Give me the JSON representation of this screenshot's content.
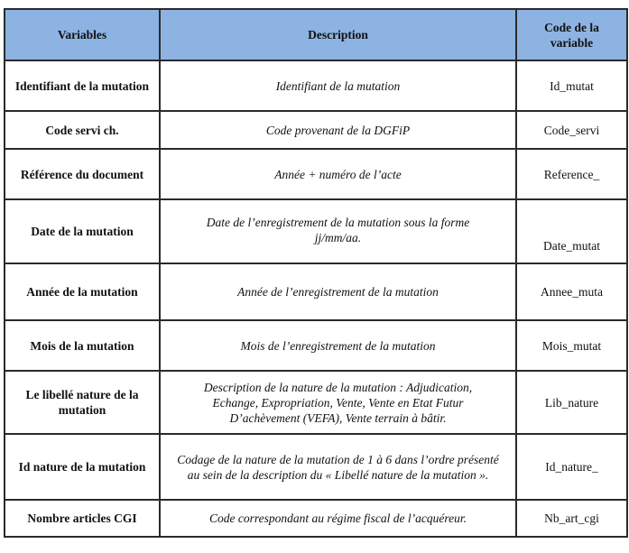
{
  "table": {
    "headers": {
      "variables": "Variables",
      "description": "Description",
      "code": "Code de la variable"
    },
    "header_color": "#8db3e2",
    "rows": [
      {
        "variable": "Identifiant de la mutation",
        "description": "Identifiant de la mutation",
        "code": "Id_mutat"
      },
      {
        "variable": "Code servi ch.",
        "description": "Code provenant de la DGFiP",
        "code": "Code_servi"
      },
      {
        "variable": "Référence du document",
        "description": "Année + numéro de l’acte",
        "code": "Reference_"
      },
      {
        "variable": "Date de la mutation",
        "description": "Date de l’enregistrement de la mutation sous la forme jj/mm/aa.",
        "code": "Date_mutat"
      },
      {
        "variable": "Année de la mutation",
        "description": "Année de l’enregistrement de la mutation",
        "code": "Annee_muta"
      },
      {
        "variable": "Mois de la mutation",
        "description": "Mois de l’enregistrement de la mutation",
        "code": "Mois_mutat"
      },
      {
        "variable": "Le libellé nature de la mutation",
        "description": "Description de la nature de la mutation : Adjudication, Echange, Expropriation, Vente, Vente en Etat Futur D’achèvement (VEFA), Vente terrain à bâtir.",
        "code": "Lib_nature"
      },
      {
        "variable": "Id nature de la mutation",
        "description": "Codage de la nature de la mutation de 1 à 6 dans l’ordre présenté au sein de la description du « Libellé nature de la mutation ».",
        "code": "Id_nature_"
      },
      {
        "variable": "Nombre articles CGI",
        "description": "Code correspondant au régime fiscal de l’acquéreur.",
        "code": "Nb_art_cgi"
      }
    ]
  }
}
